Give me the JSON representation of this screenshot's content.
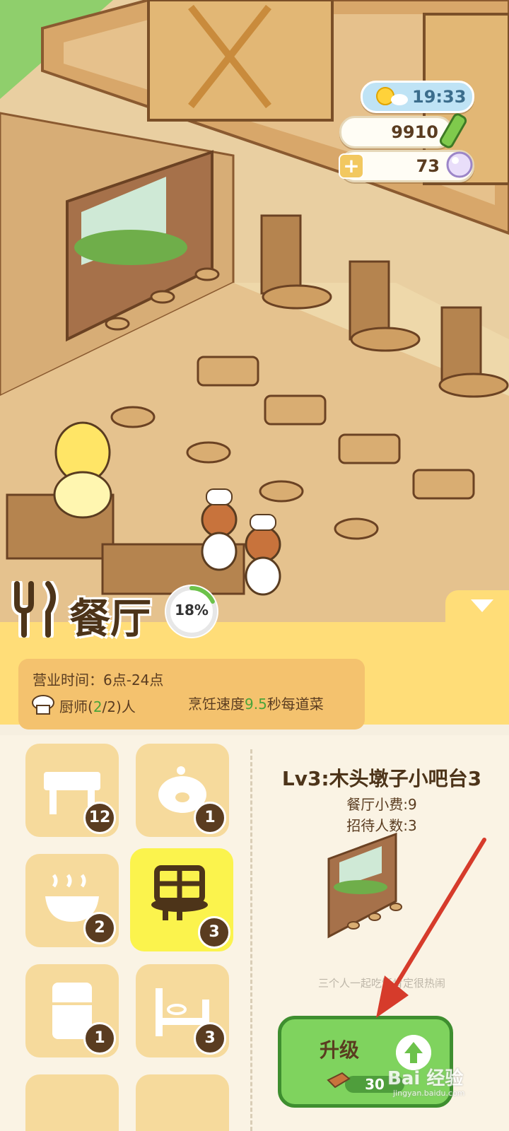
{
  "hud": {
    "time": "19:33",
    "coins": "9910",
    "pearls": "73",
    "plus": "+"
  },
  "header": {
    "title": "餐厅",
    "progress_label": "18%",
    "progress": 0.18
  },
  "info": {
    "hours": "营业时间：6点-24点",
    "chef_prefix": "厨师(",
    "chef_current": "2",
    "chef_suffix": "/2)人",
    "speed_prefix": "烹饪速度",
    "speed_value": "9.5",
    "speed_suffix": "秒每道菜"
  },
  "categories": [
    {
      "name": "table",
      "count": "12",
      "active": false
    },
    {
      "name": "piggy",
      "count": "1",
      "active": false
    },
    {
      "name": "pot",
      "count": "2",
      "active": false
    },
    {
      "name": "bar",
      "count": "3",
      "active": true
    },
    {
      "name": "fridge",
      "count": "1",
      "active": false
    },
    {
      "name": "bed",
      "count": "3",
      "active": false
    }
  ],
  "detail": {
    "title": "Lv3:木头墩子小吧台3",
    "tip": "餐厅小费:9",
    "guests": "招待人数:3",
    "description": "三个人一起吃饭肯定很热闹"
  },
  "upgrade": {
    "label": "升级",
    "cost": "30"
  },
  "watermark": {
    "text": "Bai 经验",
    "sub": "jingyan.baidu.com"
  },
  "colors": {
    "accent_yellow": "#ffdd78",
    "upgrade_green": "#7fd35e",
    "annotation_red": "#d63b2b"
  }
}
